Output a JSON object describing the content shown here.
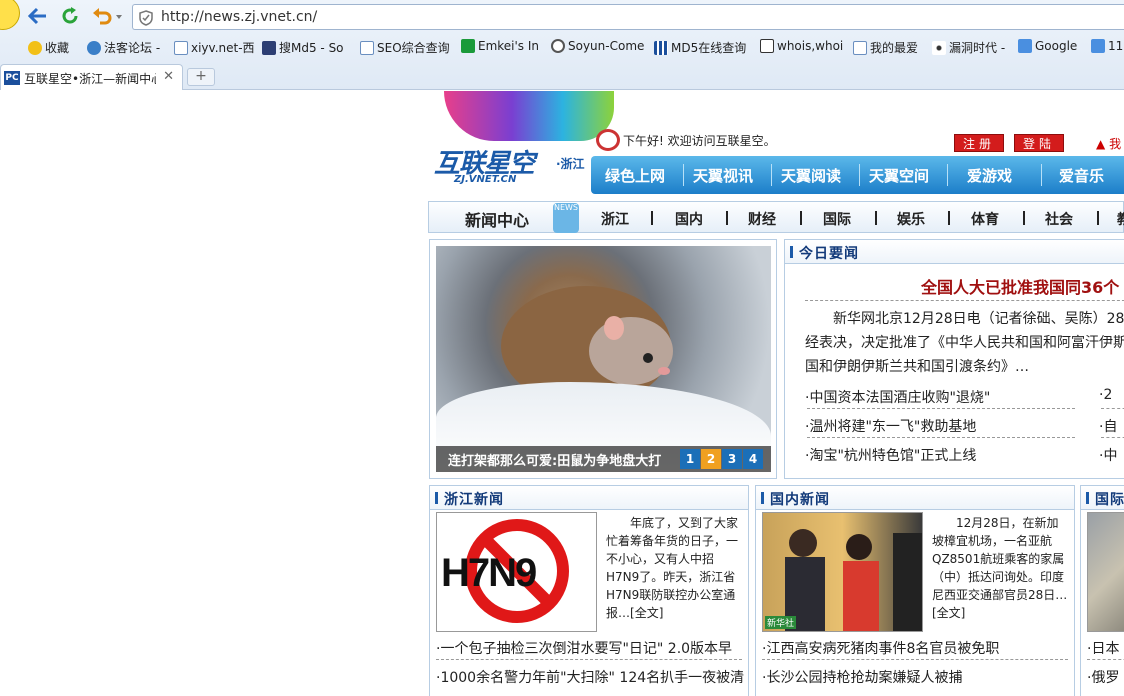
{
  "browser": {
    "url": "http://news.zj.vnet.cn/",
    "bookmarks": [
      "收藏",
      "法客论坛 -",
      "xiyv.net-西",
      "搜Md5 - So",
      "SEO综合查询",
      "Emkei's In",
      "Soyun-Come",
      "MD5在线查询",
      "whois,whoi",
      "我的最爱",
      "漏洞时代 -",
      "Google",
      "11"
    ],
    "tab_title": "互联星空•浙江—新闻中心",
    "tab_favicon": "PC",
    "new_tab": "+",
    "accent": "#1b5aa8"
  },
  "site": {
    "logo": "互联星空",
    "logo_sub": "·浙江",
    "logo_url": "ZJ.VNET.CN",
    "greeting": "下午好! 欢迎访问互联星空。",
    "register": "注册",
    "login": "登陆",
    "user": "我",
    "top_nav": [
      "绿色上网",
      "天翼视讯",
      "天翼阅读",
      "天翼空间",
      "爱游戏",
      "爱音乐"
    ],
    "news_center": "新闻中心",
    "news_badge": "NEWS",
    "categories": [
      "浙江",
      "国内",
      "财经",
      "国际",
      "娱乐",
      "体育",
      "社会",
      "教"
    ]
  },
  "slideshow": {
    "caption": "连打架都那么可爱:田鼠为争地盘大打",
    "pages": [
      "1",
      "2",
      "3",
      "4"
    ],
    "active_page": "2"
  },
  "today": {
    "title": "今日要闻",
    "headline": "全国人大已批准我国同36个",
    "summary": [
      "新华网北京12月28日电（记者徐础、吴陈）28日",
      "经表决，决定批准了《中华人民共和国和阿富汗伊斯",
      "国和伊朗伊斯兰共和国引渡条约》…"
    ],
    "links": [
      "中国资本法国酒庄收购\"退烧\"",
      "温州将建\"东一飞\"救助基地",
      "淘宝\"杭州特色馆\"正式上线"
    ],
    "links_right": [
      "2",
      "自",
      "中"
    ]
  },
  "zhejiang": {
    "title": "浙江新闻",
    "thumb_text": "H7N9",
    "blurb": "年底了，又到了大家忙着筹备年货的日子，一不小心，又有人中招H7N9了。昨天，浙江省H7N9联防联控办公室通报…",
    "more": "[全文]",
    "links": [
      "一个包子抽检三次倒泔水要写\"日记\" 2.0版本早",
      "1000余名警力年前\"大扫除\" 124名扒手一夜被清"
    ]
  },
  "domestic": {
    "title": "国内新闻",
    "blurb": "12月28日，在新加坡樟宜机场，一名亚航QZ8501航班乘客的家属（中）抵达问询处。印度尼西亚交通部官员28日…",
    "more": "[全文]",
    "photo_badge": "新华社",
    "links": [
      "江西高安病死猪肉事件8名官员被免职",
      "长沙公园持枪抢劫案嫌疑人被捕"
    ]
  },
  "international": {
    "title": "国际",
    "links": [
      "日本",
      "俄罗"
    ]
  }
}
